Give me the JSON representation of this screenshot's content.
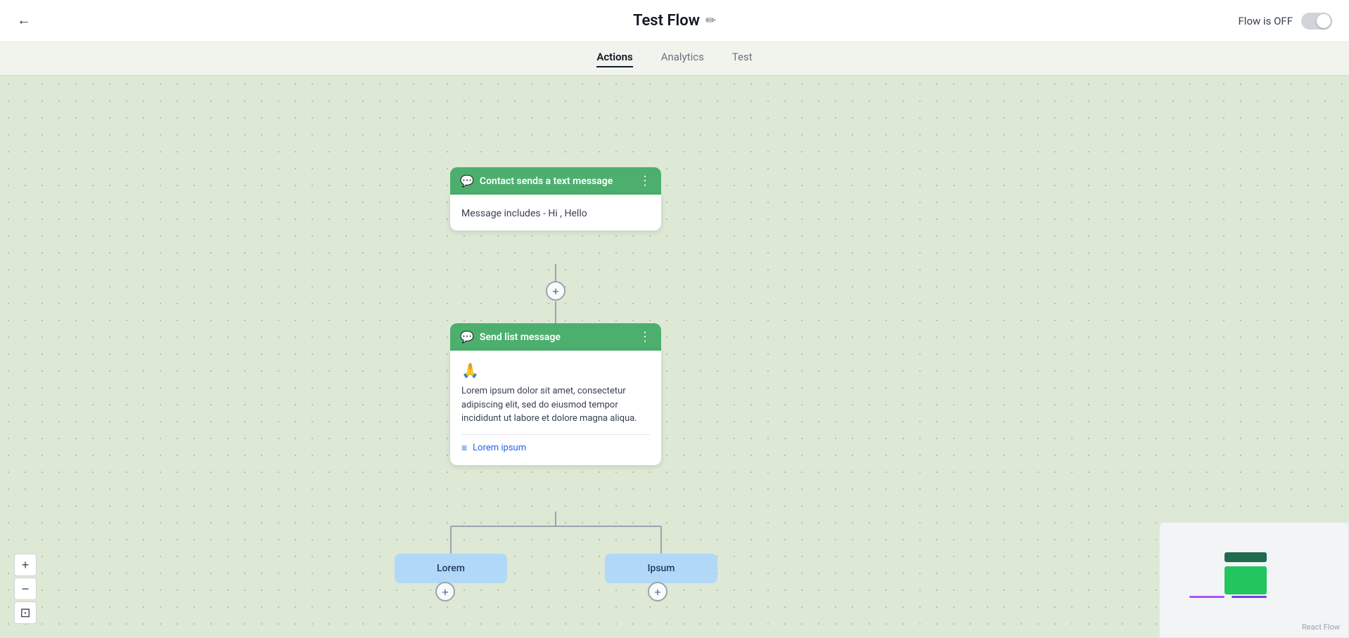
{
  "header": {
    "back_label": "←",
    "title": "Test Flow",
    "edit_icon": "✏",
    "flow_status": "Flow is OFF"
  },
  "tabs": [
    {
      "id": "actions",
      "label": "Actions",
      "active": true
    },
    {
      "id": "analytics",
      "label": "Analytics",
      "active": false
    },
    {
      "id": "test",
      "label": "Test",
      "active": false
    }
  ],
  "canvas": {
    "trigger_node": {
      "title": "Contact sends a text message",
      "body": "Message includes - Hi , Hello"
    },
    "action_node": {
      "title": "Send list message",
      "emoji": "🙏",
      "body_text": "Lorem ipsum dolor sit amet, consectetur adipiscing elit, sed do eiusmod tempor incididunt ut labore et dolore magna aliqua.",
      "list_label": "Lorem ipsum"
    },
    "branch_left": "Lorem",
    "branch_right": "Ipsum",
    "add_plus": "+",
    "react_flow_label": "React Flow"
  },
  "zoom_controls": {
    "zoom_in": "+",
    "zoom_out": "−",
    "fit": "⊡"
  }
}
